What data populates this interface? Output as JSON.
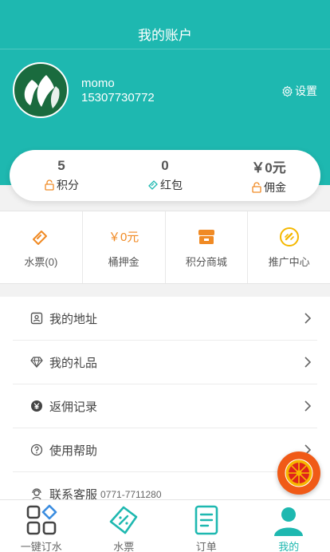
{
  "header": {
    "title": "我的账户"
  },
  "profile": {
    "name": "momo",
    "phone": "15307730772",
    "settings_label": "设置",
    "avatar_color": "#1a6b3e"
  },
  "stats": [
    {
      "value": "5",
      "label": "积分",
      "icon": "lock-icon"
    },
    {
      "value": "0",
      "label": "红包",
      "icon": "ticket-icon"
    },
    {
      "value": "￥0元",
      "label": "佣金",
      "icon": "lock-icon"
    }
  ],
  "grid": [
    {
      "label": "水票(0)",
      "icon": "water-ticket-icon"
    },
    {
      "value": "￥0元",
      "label": "桶押金"
    },
    {
      "label": "积分商城",
      "icon": "store-icon"
    },
    {
      "label": "推广中心",
      "icon": "link-icon"
    }
  ],
  "menu": [
    {
      "label": "我的地址",
      "icon": "address-card-icon"
    },
    {
      "label": "我的礼品",
      "icon": "diamond-icon"
    },
    {
      "label": "返佣记录",
      "icon": "yen-coin-icon"
    },
    {
      "label": "使用帮助",
      "icon": "help-icon"
    },
    {
      "label": "联系客服",
      "extra": "0771-7711280",
      "icon": "support-icon"
    }
  ],
  "tabs": [
    {
      "label": "一键订水",
      "icon": "grid-icon"
    },
    {
      "label": "水票",
      "icon": "ticket-icon"
    },
    {
      "label": "订单",
      "icon": "order-list-icon"
    },
    {
      "label": "我的",
      "icon": "user-icon",
      "active": true
    }
  ],
  "colors": {
    "primary": "#1eb8b0",
    "accent": "#f08a24",
    "fab": "#f05a17"
  }
}
